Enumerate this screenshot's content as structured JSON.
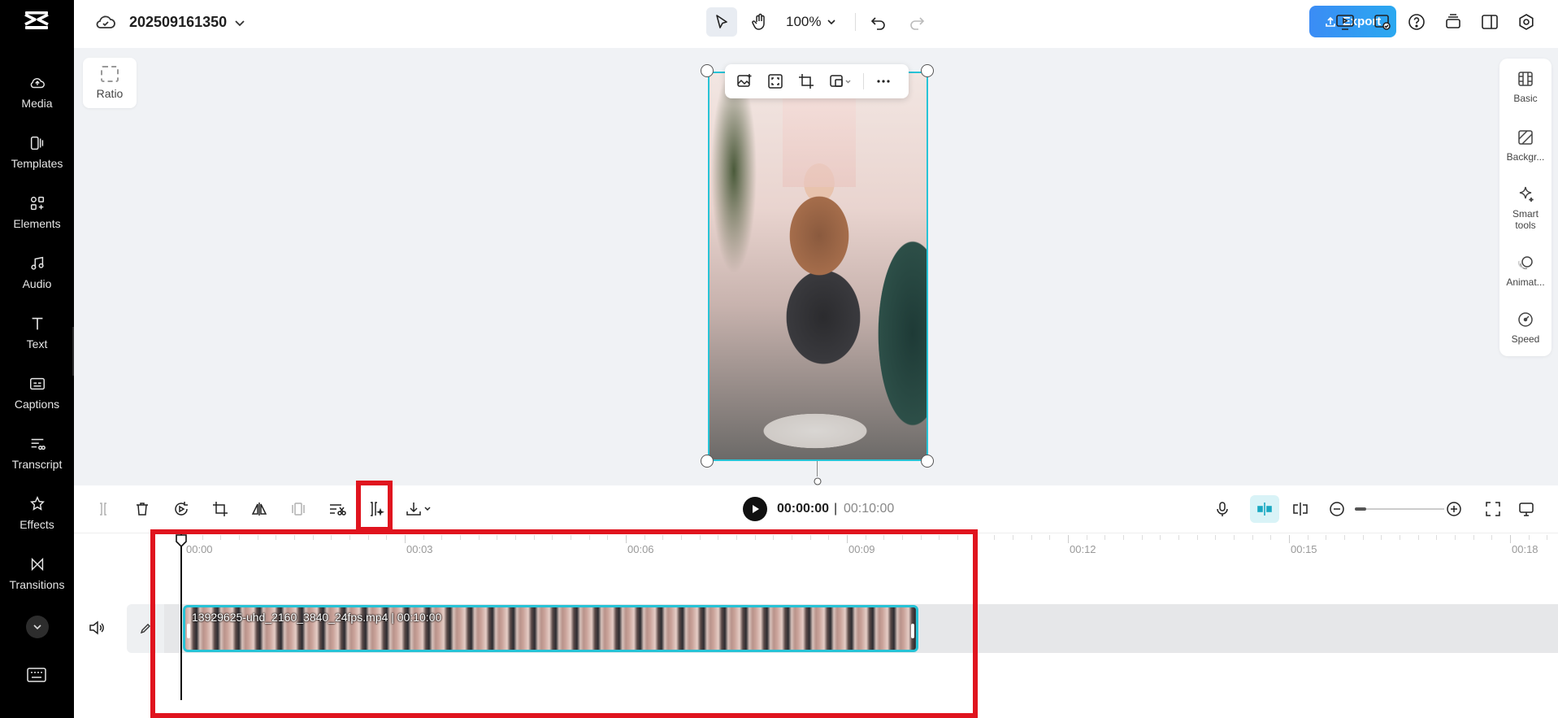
{
  "project": {
    "title": "202509161350"
  },
  "rail": {
    "items": [
      {
        "label": "Media",
        "icon": "cloud-upload-icon"
      },
      {
        "label": "Templates",
        "icon": "templates-icon"
      },
      {
        "label": "Elements",
        "icon": "elements-icon"
      },
      {
        "label": "Audio",
        "icon": "music-note-icon"
      },
      {
        "label": "Text",
        "icon": "text-icon"
      },
      {
        "label": "Captions",
        "icon": "captions-icon"
      },
      {
        "label": "Transcript",
        "icon": "transcript-icon"
      },
      {
        "label": "Effects",
        "icon": "effects-star-icon"
      },
      {
        "label": "Transitions",
        "icon": "transitions-icon"
      }
    ]
  },
  "topbar": {
    "zoom": "100%",
    "export_label": "Export"
  },
  "canvas": {
    "ratio_label": "Ratio"
  },
  "right_panel": {
    "items": [
      {
        "label": "Basic",
        "icon": "basic-icon"
      },
      {
        "label": "Backgr...",
        "icon": "background-icon"
      },
      {
        "label": "Smart tools",
        "icon": "sparkle-icon"
      },
      {
        "label": "Animat...",
        "icon": "animation-icon"
      },
      {
        "label": "Speed",
        "icon": "speed-gauge-icon"
      }
    ]
  },
  "playback": {
    "current_time": "00:00:00",
    "separator": "|",
    "total_time": "00:10:00"
  },
  "timeline": {
    "ruler_labels": [
      "00:00",
      "00:03",
      "00:06",
      "00:09",
      "00:12",
      "00:15",
      "00:18"
    ],
    "clip": {
      "filename": "13929625-uhd_2160_3840_24fps.mp4",
      "duration": "00:10:00"
    }
  },
  "colors": {
    "accent": "#27c3d6",
    "export": "#3b8cf5",
    "highlight": "#e0141e"
  }
}
